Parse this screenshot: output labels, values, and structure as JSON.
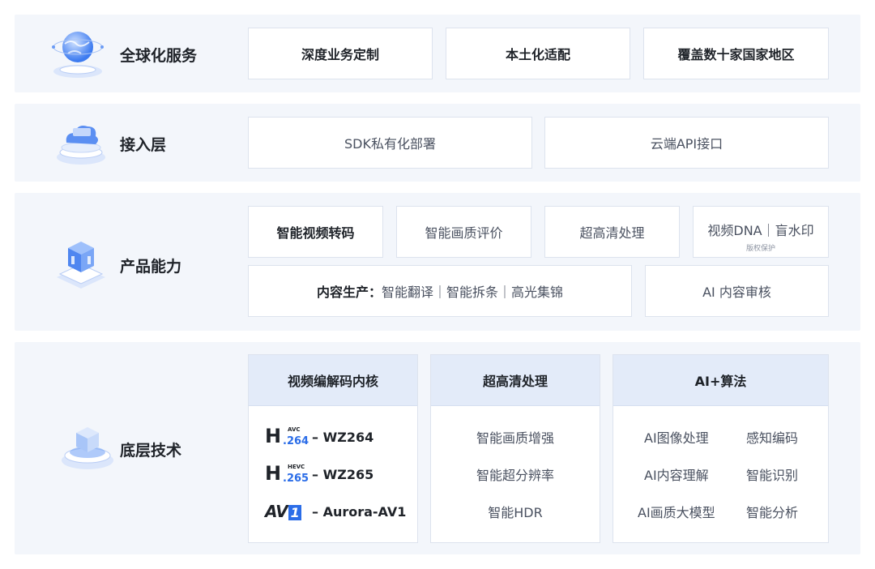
{
  "layers": [
    {
      "label": "全球化服务",
      "icon": "globe-icon",
      "boxes": [
        {
          "text": "深度业务定制"
        },
        {
          "text": "本土化适配"
        },
        {
          "text": "覆盖数十家国家地区"
        }
      ]
    },
    {
      "label": "接入层",
      "icon": "cloud-device-icon",
      "boxes": [
        {
          "text": "SDK私有化部署"
        },
        {
          "text": "云端API接口"
        }
      ]
    },
    {
      "label": "产品能力",
      "icon": "cube-platform-icon",
      "boxes": [
        {
          "text": "智能视频转码"
        },
        {
          "text": "智能画质评价"
        },
        {
          "text": "超高清处理"
        },
        {
          "text": "视频DNA｜盲水印",
          "sub": "版权保护"
        },
        {
          "text_bold": "内容生产：",
          "text": "智能翻译｜智能拆条｜高光集锦"
        },
        {
          "text": "AI 内容审核"
        }
      ]
    },
    {
      "label": "底层技术",
      "icon": "chip-platform-icon",
      "columns": [
        {
          "title": "视频编解码内核",
          "codecs": [
            {
              "logo_main": "H",
              "logo_tag": "AVC",
              "logo_num": ".264",
              "name": "– WZ264"
            },
            {
              "logo_main": "H",
              "logo_tag": "HEVC",
              "logo_num": ".265",
              "name": "– WZ265"
            },
            {
              "logo_main": "AV",
              "logo_num": "1",
              "name": "– Aurora-AV1"
            }
          ]
        },
        {
          "title": "超高清处理",
          "items": [
            "智能画质增强",
            "智能超分辨率",
            "智能HDR"
          ]
        },
        {
          "title": "AI+算法",
          "items": [
            "AI图像处理",
            "感知编码",
            "AI内容理解",
            "智能识别",
            "AI画质大模型",
            "智能分析"
          ]
        }
      ]
    }
  ],
  "colors": {
    "band_bg": "#f3f6fb",
    "box_border": "#dde3ee",
    "column_head": "#e3ebf9",
    "accent": "#2b6de8"
  }
}
